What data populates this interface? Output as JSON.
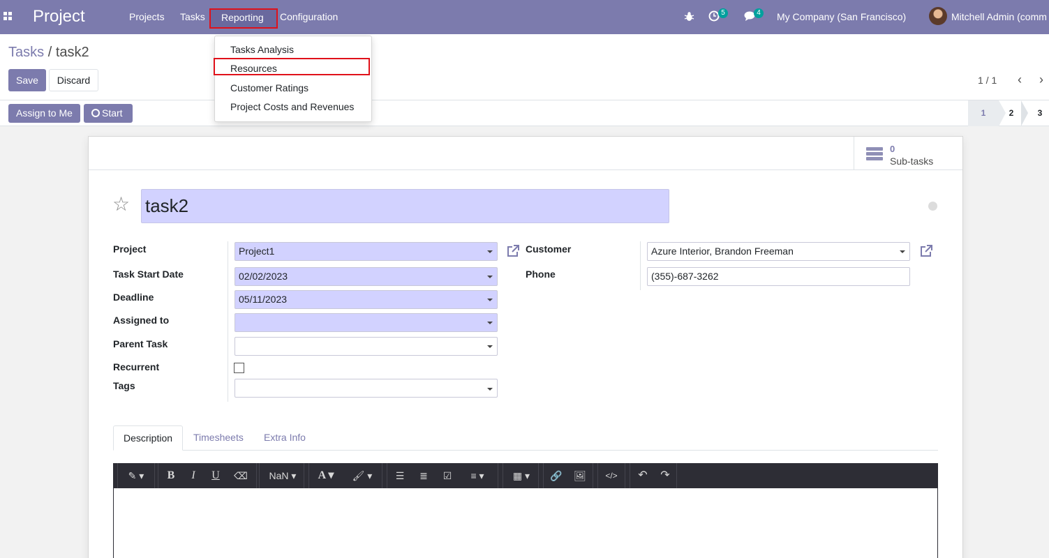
{
  "navbar": {
    "app_name": "Project",
    "menu": [
      "Projects",
      "Tasks",
      "Reporting",
      "Configuration"
    ],
    "activity_count": "5",
    "messages_count": "4",
    "company": "My Company (San Francisco)",
    "user": "Mitchell Admin (comm"
  },
  "reporting_menu": {
    "items": [
      "Tasks Analysis",
      "Resources",
      "Customer Ratings",
      "Project Costs and Revenues"
    ]
  },
  "breadcrumb": {
    "parent": "Tasks",
    "separator": "/",
    "current": "task2"
  },
  "buttons": {
    "save": "Save",
    "discard": "Discard",
    "assign_to_me": "Assign to Me",
    "start": "Start"
  },
  "pager": {
    "value": "1 / 1"
  },
  "stages": [
    "1",
    "2",
    "3"
  ],
  "subtasks": {
    "count": "0",
    "label": "Sub-tasks"
  },
  "task": {
    "name": "task2",
    "labels": {
      "project": "Project",
      "start_date": "Task Start Date",
      "deadline": "Deadline",
      "assigned_to": "Assigned to",
      "parent_task": "Parent Task",
      "recurrent": "Recurrent",
      "tags": "Tags",
      "customer": "Customer",
      "phone": "Phone"
    },
    "values": {
      "project": "Project1",
      "start_date": "02/02/2023",
      "deadline": "05/11/2023",
      "assigned_to": "",
      "parent_task": "",
      "recurrent": false,
      "tags": "",
      "customer": "Azure Interior, Brandon Freeman",
      "phone": "(355)-687-3262"
    }
  },
  "tabs": [
    "Description",
    "Timesheets",
    "Extra Info"
  ],
  "editor_toolbar": {
    "font_size": "NaN"
  },
  "colors": {
    "brand": "#7c7bad",
    "required_field": "#d2d2ff",
    "highlight": "#e0111a",
    "badge": "#00a09d"
  }
}
